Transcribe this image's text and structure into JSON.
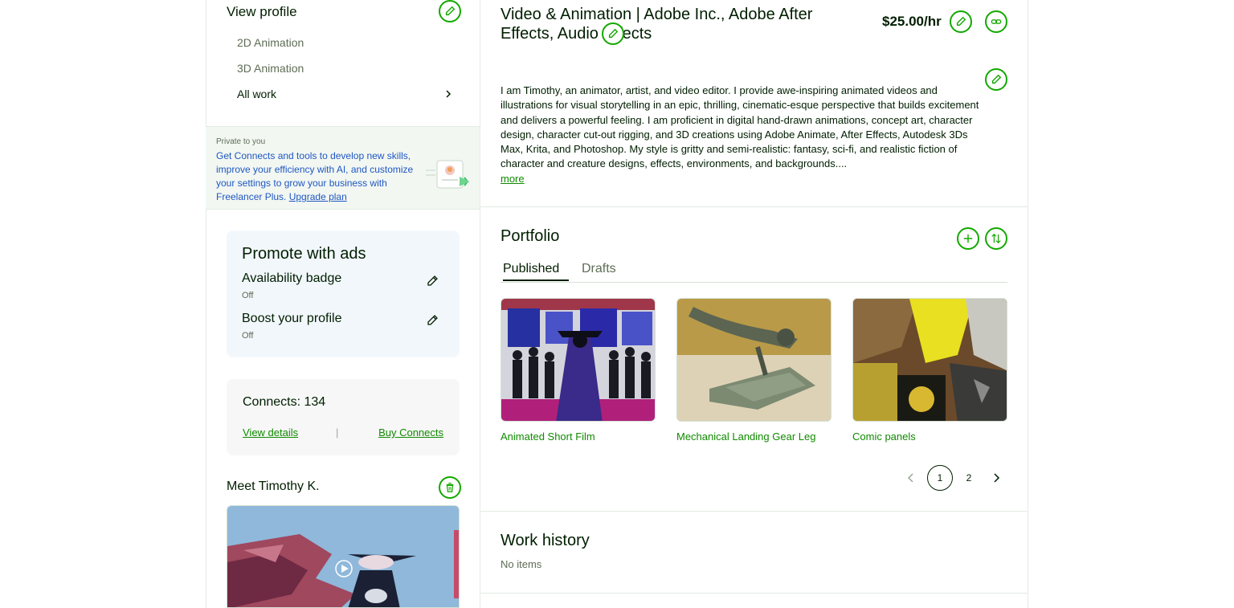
{
  "sidebar": {
    "view_profile": "View profile",
    "categories": [
      "2D Animation",
      "3D Animation"
    ],
    "all_work": "All work",
    "private": {
      "label": "Private to you",
      "message": "Get Connects and tools to develop new skills, improve your efficiency with AI, and customize your settings to grow your business with Freelancer Plus.",
      "upgrade": "Upgrade plan"
    },
    "promote": {
      "title": "Promote with ads",
      "availability_title": "Availability badge",
      "availability_state": "Off",
      "boost_title": "Boost your profile",
      "boost_state": "Off"
    },
    "connects": {
      "title": "Connects: 134",
      "view_details": "View details",
      "separator": "|",
      "buy": "Buy Connects"
    },
    "meet": "Meet Timothy K."
  },
  "profile": {
    "title": "Video & Animation | Adobe Inc., Adobe After Effects, Audio Effects",
    "rate": "$25.00/hr",
    "description": "I am Timothy, an animator, artist, and video editor. I provide awe-inspiring animated videos and illustrations for visual storytelling in an epic, thrilling, cinematic-esque perspective that builds excitement and delivers a powerful feeling. I am proficient in digital hand-drawn animations, concept art, character design, character cut-out rigging, and 3D creations using Adobe Animate, After Effects, Autodesk 3Ds Max, Krita, and Photoshop. My style is gritty and semi-realistic: fantasy, sci-fi, and realistic fiction of character and creature designs, effects, environments, and backgrounds....",
    "more": "more"
  },
  "portfolio": {
    "title": "Portfolio",
    "tabs": [
      "Published",
      "Drafts"
    ],
    "items": [
      "Animated Short Film",
      "Mechanical Landing Gear Leg",
      "Comic panels"
    ],
    "pages": [
      "1",
      "2"
    ],
    "current_page": "1"
  },
  "work_history": {
    "title": "Work history",
    "empty": "No items"
  },
  "colors": {
    "accent": "#14a800",
    "link": "#108a00",
    "private_bg": "#f2f7f2",
    "promo_bg": "#f2f7fc"
  },
  "icons": [
    "pencil-icon",
    "link-icon",
    "plus-icon",
    "sort-icon",
    "trash-icon",
    "chevron-right-icon",
    "chevron-left-icon",
    "play-icon"
  ]
}
